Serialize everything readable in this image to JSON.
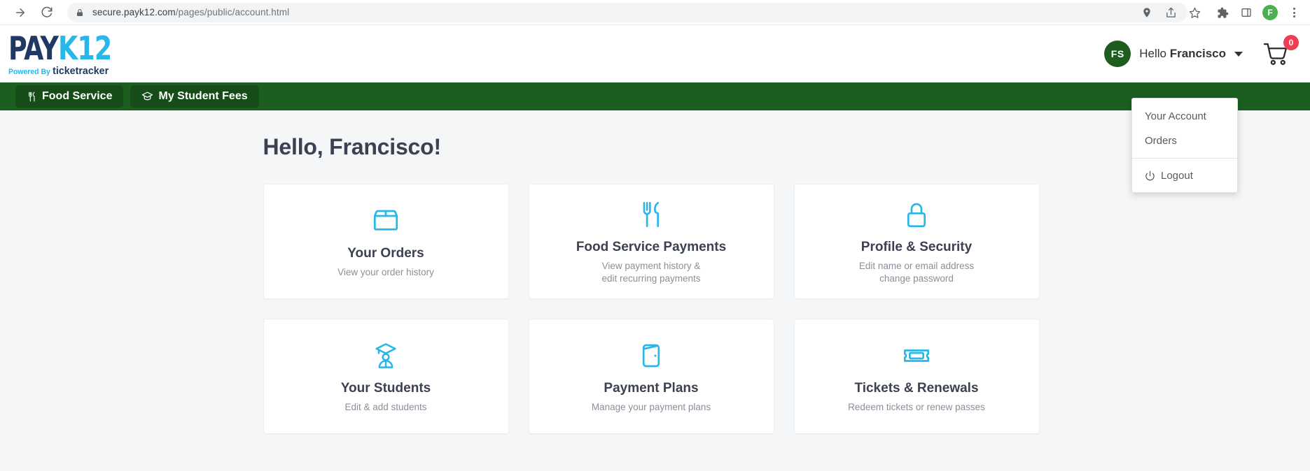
{
  "browser": {
    "url_secure": "secure.payk12.com",
    "url_path": "/pages/public/account.html",
    "forward_icon": "forward-arrow-icon",
    "reload_icon": "reload-icon",
    "lock_icon": "lock-icon",
    "toolbar_icons": [
      "location-pin-icon",
      "share-icon",
      "bookmark-star-icon",
      "extensions-puzzle-icon",
      "sidepanel-icon"
    ],
    "profile_initial": "F",
    "profile_color": "#4caf50",
    "menu_icon": "kebab-menu-icon"
  },
  "header": {
    "logo_pay": "PAY",
    "logo_k12": "K12",
    "logo_powered_by": "Powered By",
    "logo_ticketracker": "ticketracker",
    "avatar_initials": "FS",
    "greeting_prefix": "Hello ",
    "greeting_name": "Francisco",
    "cart_count": "0",
    "cart_icon": "shopping-cart-icon",
    "chevron_icon": "chevron-down-icon"
  },
  "dropdown": {
    "items": [
      {
        "label": "Your Account",
        "icon": ""
      },
      {
        "label": "Orders",
        "icon": ""
      }
    ],
    "logout_label": "Logout",
    "logout_icon": "power-icon"
  },
  "navbar": {
    "tabs": [
      {
        "label": "Food Service",
        "icon": "cutlery-icon"
      },
      {
        "label": "My Student Fees",
        "icon": "graduation-cap-icon"
      }
    ]
  },
  "main": {
    "page_title": "Hello, Francisco!",
    "cards": [
      {
        "title": "Your Orders",
        "sub_line1": "View your order history",
        "sub_line2": "",
        "icon": "box-icon"
      },
      {
        "title": "Food Service Payments",
        "sub_line1": "View payment history &",
        "sub_line2": "edit recurring payments",
        "icon": "cutlery-icon"
      },
      {
        "title": "Profile & Security",
        "sub_line1": "Edit name or email address",
        "sub_line2": "change password",
        "icon": "lock-icon"
      },
      {
        "title": "Your Students",
        "sub_line1": "Edit & add students",
        "sub_line2": "",
        "icon": "graduate-icon"
      },
      {
        "title": "Payment Plans",
        "sub_line1": "Manage your payment plans",
        "sub_line2": "",
        "icon": "wallet-icon"
      },
      {
        "title": "Tickets & Renewals",
        "sub_line1": "Redeem tickets or renew passes",
        "sub_line2": "",
        "icon": "ticket-icon"
      }
    ]
  },
  "colors": {
    "brand_cyan": "#29b6e8",
    "brand_navy": "#1f3864",
    "nav_green": "#1b5e20",
    "badge_red": "#ef3e52",
    "avatar_green": "#1f5c20"
  }
}
